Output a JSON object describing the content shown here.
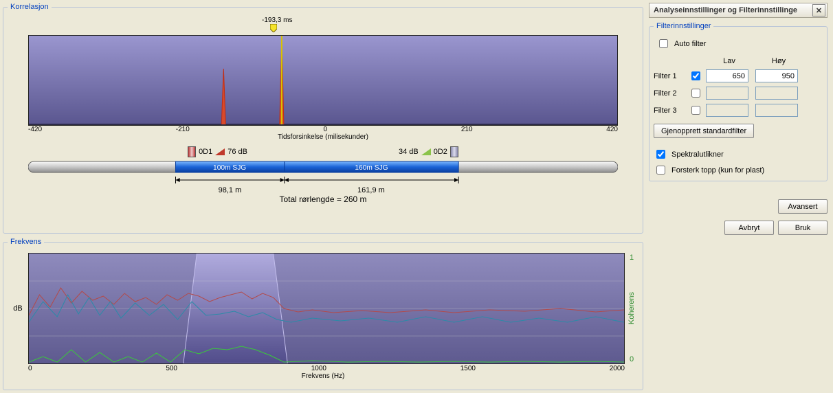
{
  "panels": {
    "correlation_title": "Korrelasjon",
    "frequency_title": "Frekvens",
    "settings_title": "Analyseinnstillinger og Filterinnstillinge",
    "filter_group_title": "Filterinnstillinger"
  },
  "correlation": {
    "peak_label": "-193,3 ms",
    "x_label": "Tidsforsinkelse (milisekunder)",
    "ticks": [
      "-420",
      "-210",
      "0",
      "210",
      "420"
    ],
    "sensor_left": "0D1",
    "sensor_left_db": "76 dB",
    "sensor_right_db": "34 dB",
    "sensor_right": "0D2",
    "pipe_left": "100m SJG",
    "pipe_right": "160m SJG",
    "dist_left": "98,1 m",
    "dist_right": "161,9 m",
    "total": "Total rørlengde = 260 m"
  },
  "frequency": {
    "y_left": "dB",
    "y_right": "Koherens",
    "y_ticks": [
      "1",
      "0"
    ],
    "x_label": "Frekvens (Hz)",
    "ticks": [
      "0",
      "500",
      "1000",
      "1500",
      "2000"
    ]
  },
  "filters": {
    "auto": "Auto filter",
    "low": "Lav",
    "high": "Høy",
    "rows": [
      {
        "label": "Filter 1",
        "checked": true,
        "low": "650",
        "high": "950"
      },
      {
        "label": "Filter 2",
        "checked": false,
        "low": "",
        "high": ""
      },
      {
        "label": "Filter 3",
        "checked": false,
        "low": "",
        "high": ""
      }
    ],
    "restore": "Gjenopprett standardfilter",
    "spectral": "Spektralutlikner",
    "enhance": "Forsterk topp (kun for plast)"
  },
  "buttons": {
    "advanced": "Avansert",
    "cancel": "Avbryt",
    "apply": "Bruk"
  },
  "chart_data": {
    "correlation": {
      "type": "line",
      "xlabel": "Tidsforsinkelse (milisekunder)",
      "xrange": [
        -420,
        420
      ],
      "peaks": [
        {
          "x": -255,
          "h": 0.62
        },
        {
          "x": -193.3,
          "h": 1.0
        }
      ],
      "marker": {
        "x": -193.3,
        "label": "-193,3 ms"
      }
    },
    "pipe": {
      "segments": [
        {
          "label": "100m SJG",
          "length_m": 100
        },
        {
          "label": "160m SJG",
          "length_m": 160
        }
      ],
      "leak_from_left_m": 98.1,
      "leak_from_right_m": 161.9,
      "total_m": 260
    },
    "spectrum": {
      "type": "line",
      "xlabel": "Frekvens (Hz)",
      "xrange": [
        0,
        2300
      ],
      "y_db_range": [
        0,
        1
      ],
      "coherence_range": [
        0,
        1
      ],
      "filter_band": [
        650,
        950
      ],
      "series": [
        "red",
        "blue",
        "coherence"
      ]
    }
  }
}
